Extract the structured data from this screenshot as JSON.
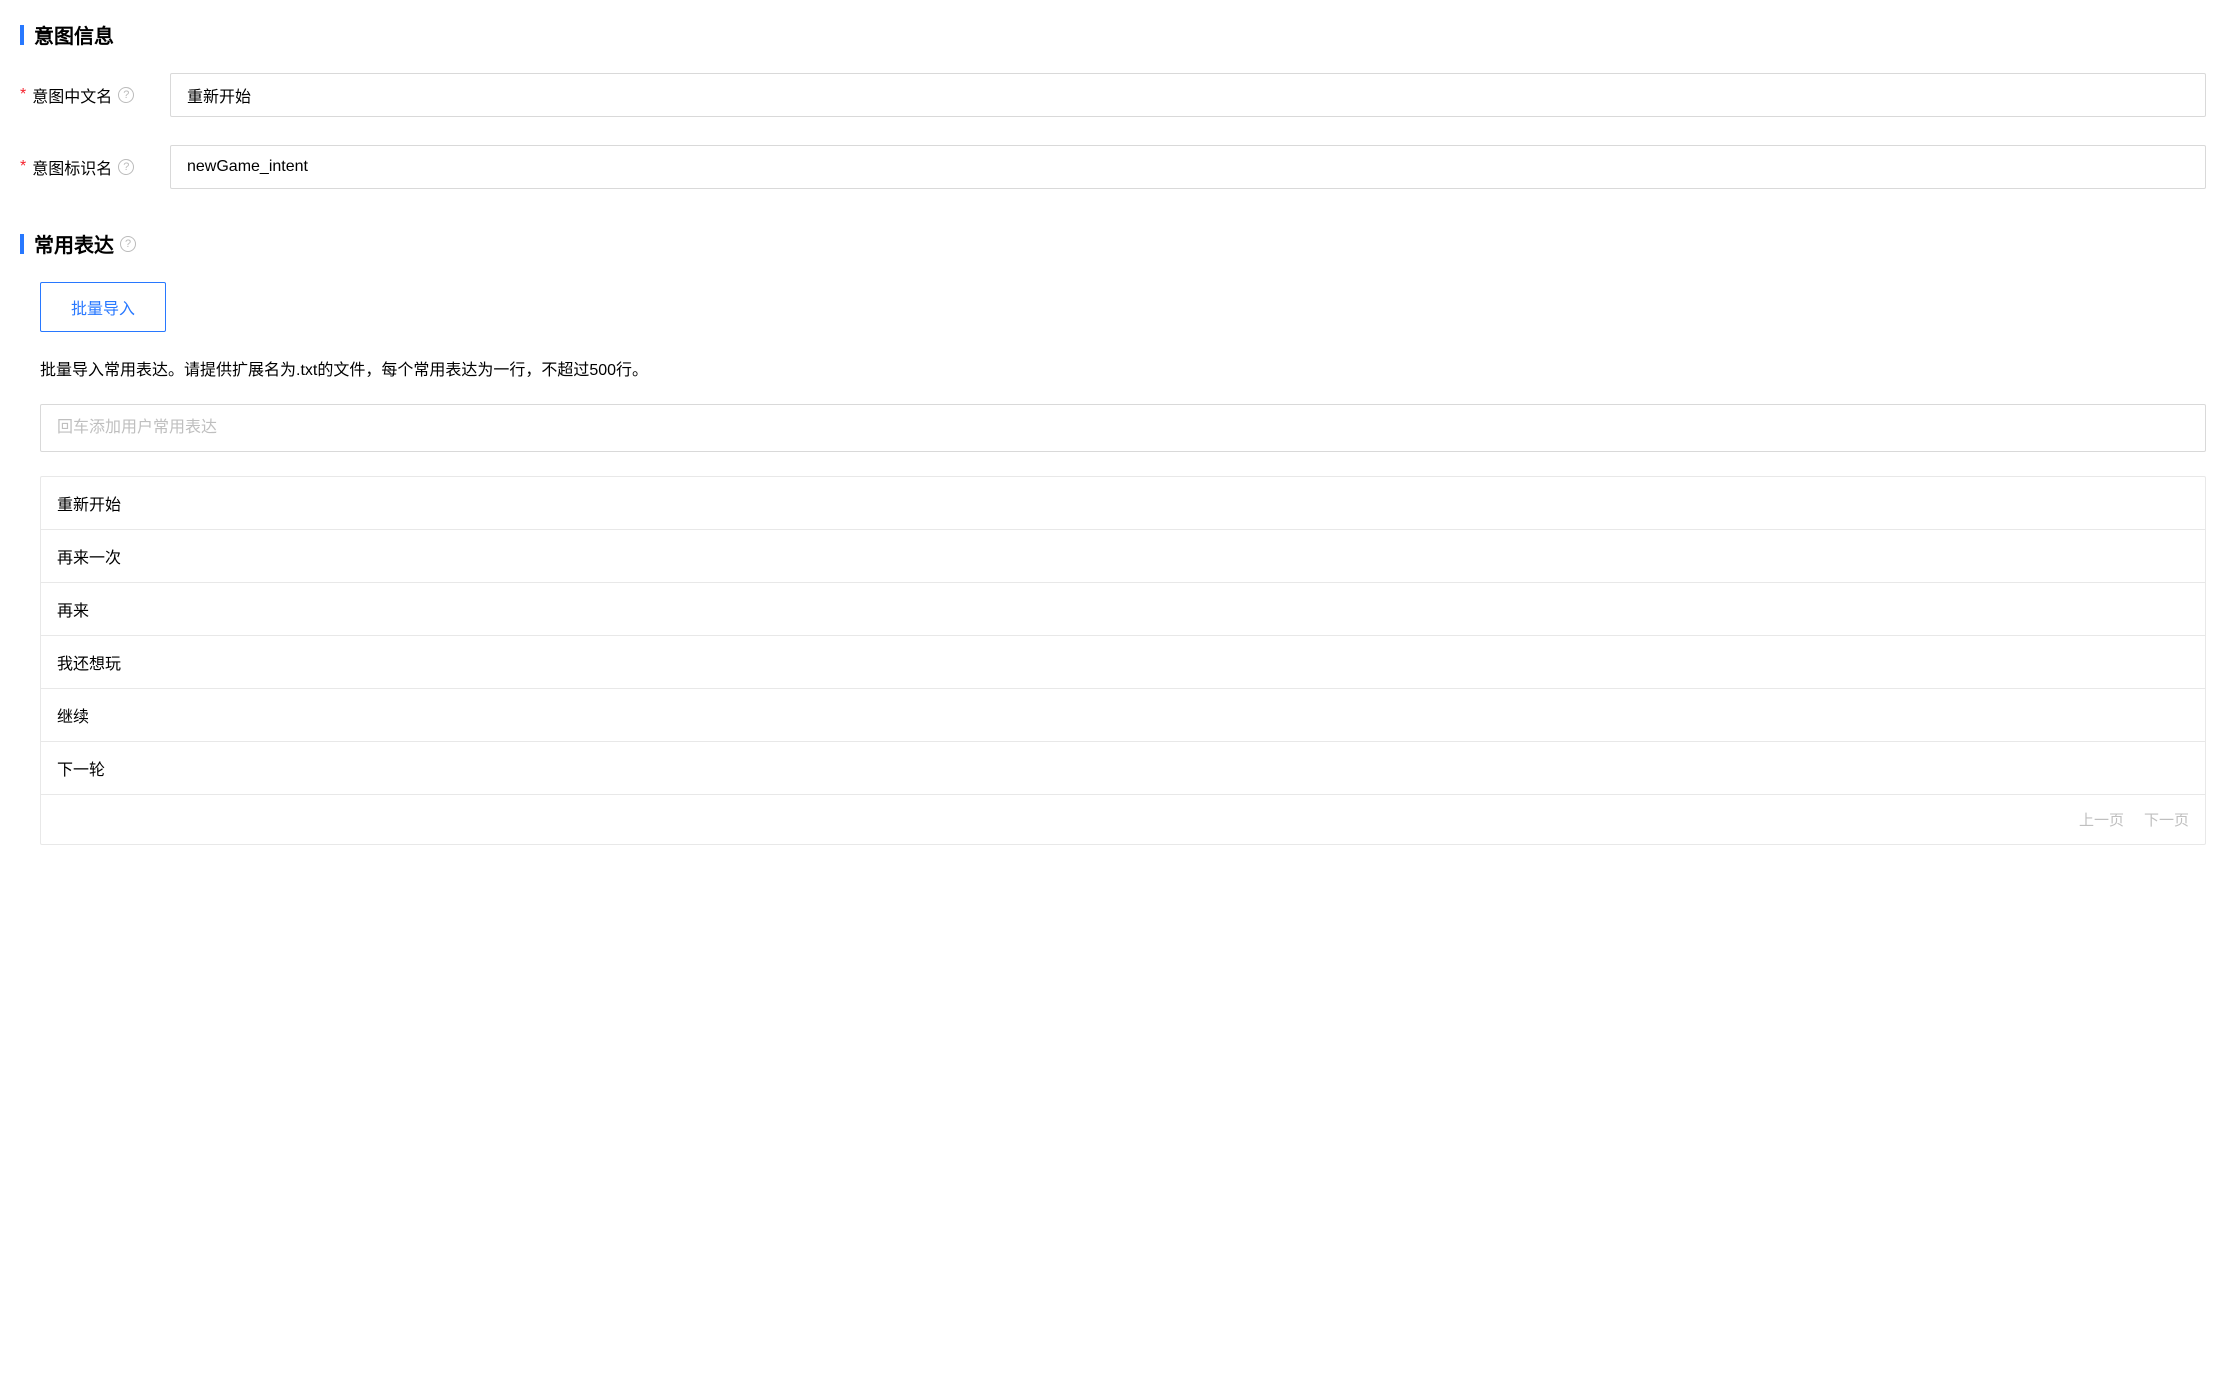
{
  "section1": {
    "title": "意图信息",
    "fields": {
      "cn_name": {
        "label": "意图中文名",
        "value": "重新开始"
      },
      "id_name": {
        "label": "意图标识名",
        "value": "newGame_intent"
      }
    }
  },
  "section2": {
    "title": "常用表达",
    "import_btn": "批量导入",
    "hint": "批量导入常用表达。请提供扩展名为.txt的文件，每个常用表达为一行，不超过500行。",
    "input_placeholder": "回车添加用户常用表达",
    "expressions": [
      "重新开始",
      "再来一次",
      "再来",
      "我还想玩",
      "继续",
      "下一轮"
    ],
    "pagination": {
      "prev": "上一页",
      "next": "下一页"
    }
  }
}
